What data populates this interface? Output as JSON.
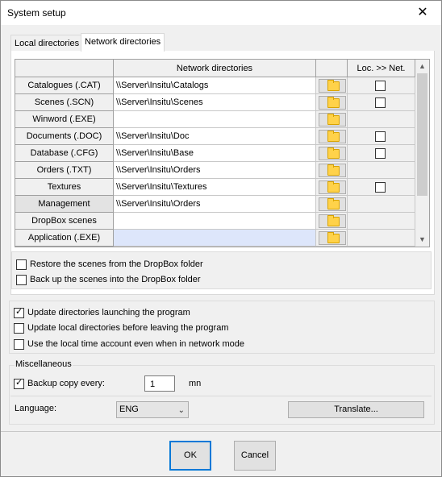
{
  "window": {
    "title": "System setup",
    "close_glyph": "✕"
  },
  "tabs": [
    {
      "label": "Local directories",
      "active": false
    },
    {
      "label": "Network directories",
      "active": true
    }
  ],
  "grid": {
    "header_dirs": "Network directories",
    "header_check": "Loc. >> Net.",
    "rows": [
      {
        "label": "Catalogues (.CAT)",
        "path": "\\\\Server\\Insitu\\Catalogs",
        "has_check": true
      },
      {
        "label": "Scenes (.SCN)",
        "path": "\\\\Server\\Insitu\\Scenes",
        "has_check": true
      },
      {
        "label": "Winword (.EXE)",
        "path": "",
        "has_check": false
      },
      {
        "label": "Documents (.DOC)",
        "path": "\\\\Server\\Insitu\\Doc",
        "has_check": true
      },
      {
        "label": "Database (.CFG)",
        "path": "\\\\Server\\Insitu\\Base",
        "has_check": true
      },
      {
        "label": "Orders (.TXT)",
        "path": "\\\\Server\\Insitu\\Orders",
        "has_check": false
      },
      {
        "label": "Textures",
        "path": "\\\\Server\\Insitu\\Textures",
        "has_check": true
      },
      {
        "label": "Management",
        "path": "\\\\Server\\Insitu\\Orders",
        "has_check": false
      },
      {
        "label": "DropBox scenes",
        "path": "",
        "has_check": false
      },
      {
        "label": "Application (.EXE)",
        "path": "",
        "has_check": false
      }
    ]
  },
  "dropbox": {
    "restore": {
      "label": "Restore the scenes from the DropBox folder",
      "checked": false
    },
    "backup": {
      "label": "Back up the scenes into the DropBox folder",
      "checked": false
    }
  },
  "options": [
    {
      "label": "Update directories launching the program",
      "checked": true
    },
    {
      "label": "Update local directories before leaving the program",
      "checked": false
    },
    {
      "label": "Use the local time account even when in network mode",
      "checked": false
    }
  ],
  "misc": {
    "title": "Miscellaneous",
    "backup_label": "Backup copy every:",
    "backup_checked": true,
    "backup_value": "1",
    "backup_unit": "mn"
  },
  "language": {
    "label": "Language:",
    "value": "ENG",
    "translate_label": "Translate..."
  },
  "footer": {
    "ok": "OK",
    "cancel": "Cancel"
  },
  "icons": {
    "folder": "folder-icon",
    "check": "✓",
    "scroll_up": "▲",
    "scroll_down": "▼",
    "dropdown": "⌄"
  }
}
